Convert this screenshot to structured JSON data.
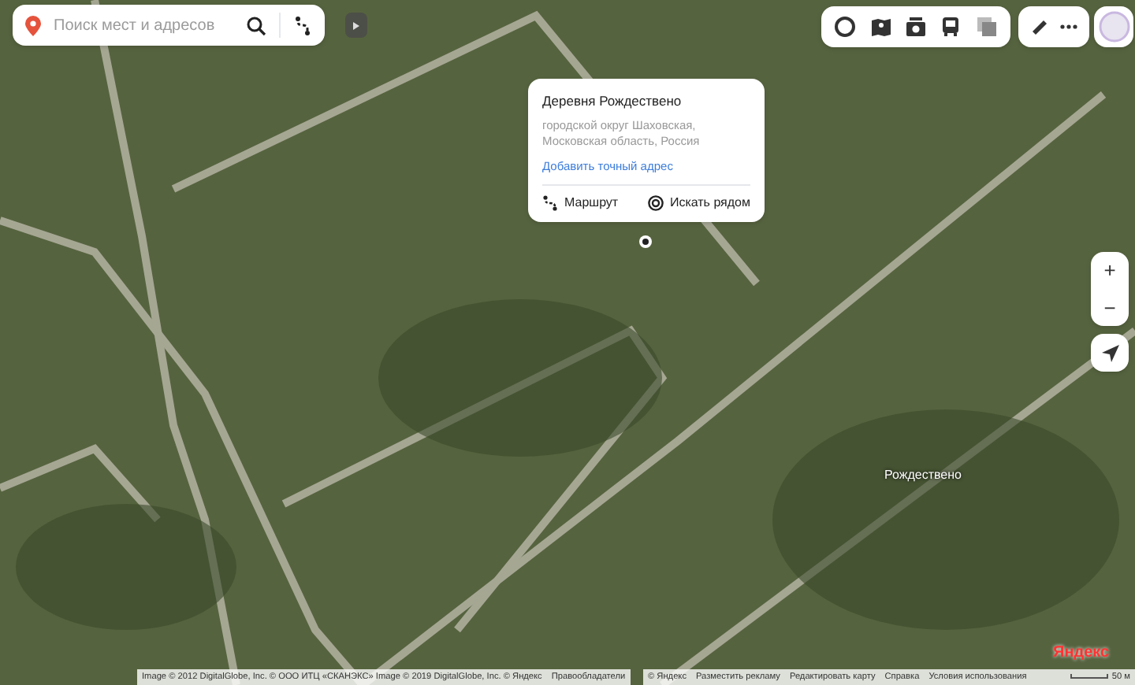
{
  "search": {
    "placeholder": "Поиск мест и адресов"
  },
  "popup": {
    "title": "Деревня Рождествено",
    "address": "городской округ Шаховская, Московская область, Россия",
    "link": "Добавить точный адрес",
    "actions": [
      "Маршрут",
      "Искать рядом"
    ]
  },
  "map_labels": [
    "Рождествено"
  ],
  "logo": "Яндекс",
  "attribution_left": [
    "Image © 2012 DigitalGlobe, Inc. © ООО ИТЦ «СКАНЭКС» Image © 2019 DigitalGlobe, Inc. © Яндекс",
    "Правообладатели"
  ],
  "attribution_right": [
    "© Яндекс",
    "Разместить рекламу",
    "Редактировать карту",
    "Справка",
    "Условия использования"
  ],
  "scale": "50 м",
  "zoom": [
    "+",
    "−"
  ]
}
